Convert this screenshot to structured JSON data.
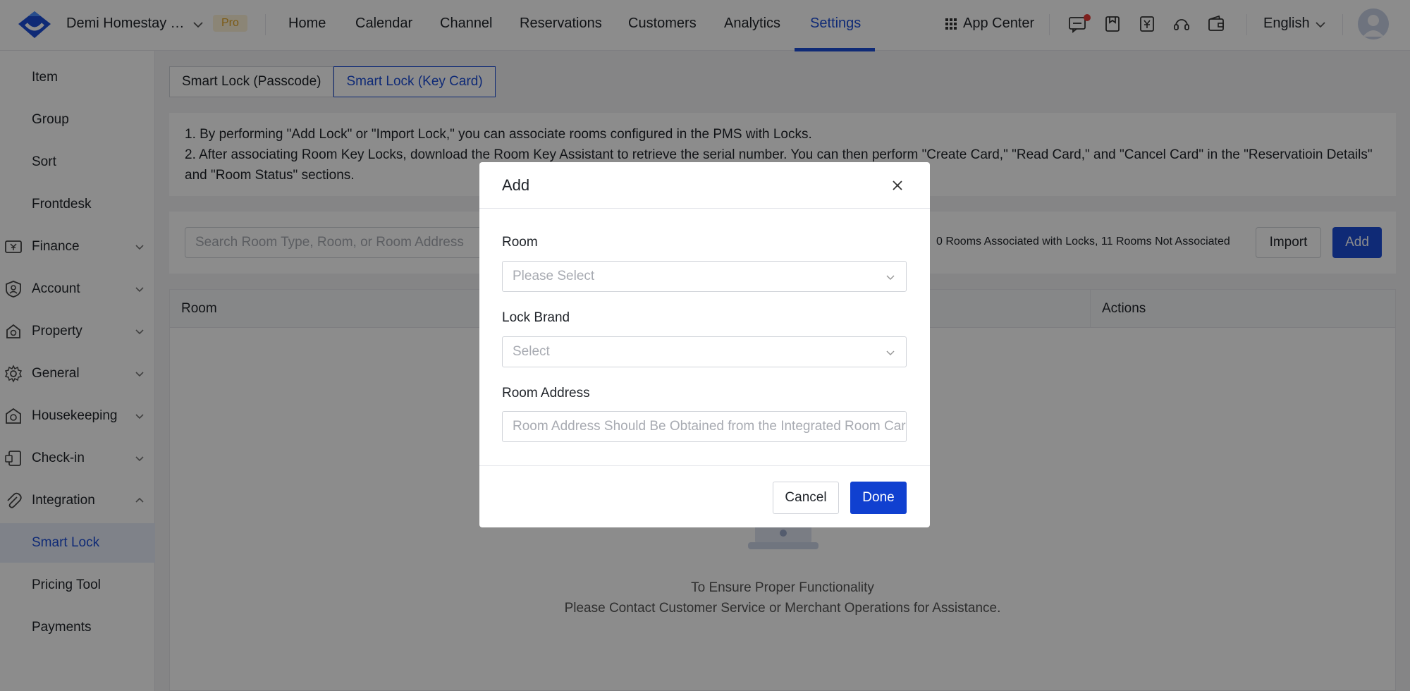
{
  "header": {
    "hotel_name": "Demi Homestay Test",
    "pro_badge": "Pro",
    "nav": [
      "Home",
      "Calendar",
      "Channel",
      "Reservations",
      "Customers",
      "Analytics",
      "Settings"
    ],
    "active_nav": "Settings",
    "app_center": "App Center",
    "language": "English",
    "icons": [
      "message-icon",
      "bookmark-icon",
      "invoice-icon",
      "headset-icon",
      "wallet-icon"
    ]
  },
  "sidebar": {
    "items": [
      {
        "label": "Item",
        "icon": ""
      },
      {
        "label": "Group",
        "icon": ""
      },
      {
        "label": "Sort",
        "icon": ""
      },
      {
        "label": "Frontdesk",
        "icon": ""
      },
      {
        "label": "Finance",
        "icon": "finance-icon"
      },
      {
        "label": "Account",
        "icon": "account-icon"
      },
      {
        "label": "Property",
        "icon": "property-icon"
      },
      {
        "label": "General",
        "icon": "gear-icon"
      },
      {
        "label": "Housekeeping",
        "icon": "housekeeping-icon"
      },
      {
        "label": "Check-in",
        "icon": "checkin-icon"
      },
      {
        "label": "Integration",
        "icon": "paperclip-icon"
      },
      {
        "label": "Smart Lock",
        "icon": ""
      },
      {
        "label": "Pricing Tool",
        "icon": ""
      },
      {
        "label": "Payments",
        "icon": ""
      }
    ],
    "active": "Smart Lock"
  },
  "main": {
    "tabs": [
      "Smart Lock (Passcode)",
      "Smart Lock (Key Card)"
    ],
    "active_tab": "Smart Lock (Key Card)",
    "info_line1": "1. By performing \"Add Lock\" or \"Import Lock,\" you can associate rooms configured in the PMS with Locks.",
    "info_line2": "2. After associating Room Key Locks, download the Room Key Assistant to retrieve the serial number. You can then perform \"Create Card,\" \"Read Card,\" and \"Cancel Card\" in the \"Reservatioin Details\" and \"Room Status\" sections.",
    "search_placeholder": "Search Room Type, Room, or Room Address",
    "stats": "0 Rooms Associated with Locks, 11 Rooms Not Associated",
    "import_label": "Import",
    "add_label": "Add",
    "columns": [
      "Room",
      "Actions"
    ],
    "empty_line1": "To Ensure Proper Functionality",
    "empty_line2": "Please Contact Customer Service or Merchant Operations for Assistance."
  },
  "modal": {
    "title": "Add",
    "room_label": "Room",
    "room_placeholder": "Please Select",
    "brand_label": "Lock Brand",
    "brand_placeholder": "Select",
    "address_label": "Room Address",
    "address_placeholder": "Room Address Should Be Obtained from the Integrated Room Card",
    "cancel_label": "Cancel",
    "done_label": "Done"
  },
  "colors": {
    "accent": "#1d4ed8",
    "pro_badge_bg": "#fdf2d8",
    "pro_badge_text": "#e0a526",
    "notification_dot": "#e53935"
  }
}
